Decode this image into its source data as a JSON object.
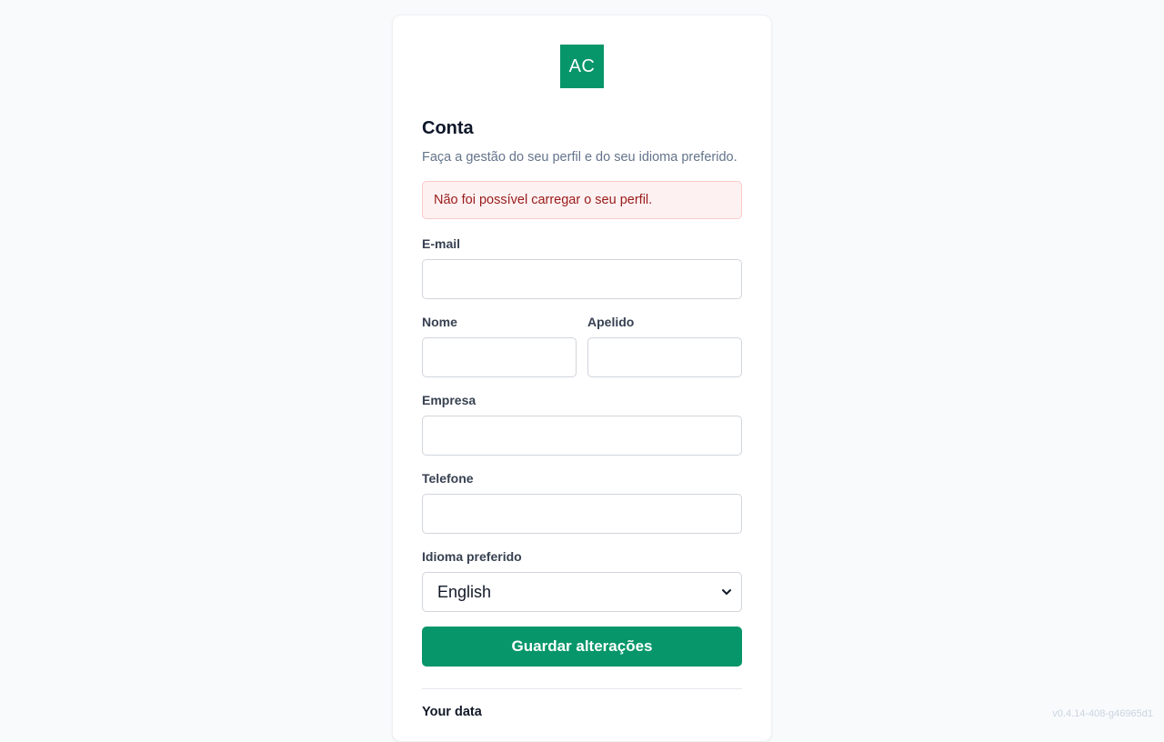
{
  "logo": {
    "text": "AC",
    "color": "#079669"
  },
  "header": {
    "title": "Conta",
    "subtitle": "Faça a gestão do seu perfil e do seu idioma preferido."
  },
  "alert": {
    "message": "Não foi possível carregar o seu perfil."
  },
  "form": {
    "email_label": "E-mail",
    "email_value": "",
    "first_name_label": "Nome",
    "first_name_value": "",
    "last_name_label": "Apelido",
    "last_name_value": "",
    "company_label": "Empresa",
    "company_value": "",
    "phone_label": "Telefone",
    "phone_value": "",
    "language_label": "Idioma preferido",
    "language_selected": "English",
    "submit_label": "Guardar alterações"
  },
  "data_section": {
    "title": "Your data"
  },
  "version": "v0.4.14-408-g46965d1",
  "colors": {
    "accent": "#079669",
    "alert_bg": "#fef1f1",
    "alert_text": "#991b1b"
  }
}
